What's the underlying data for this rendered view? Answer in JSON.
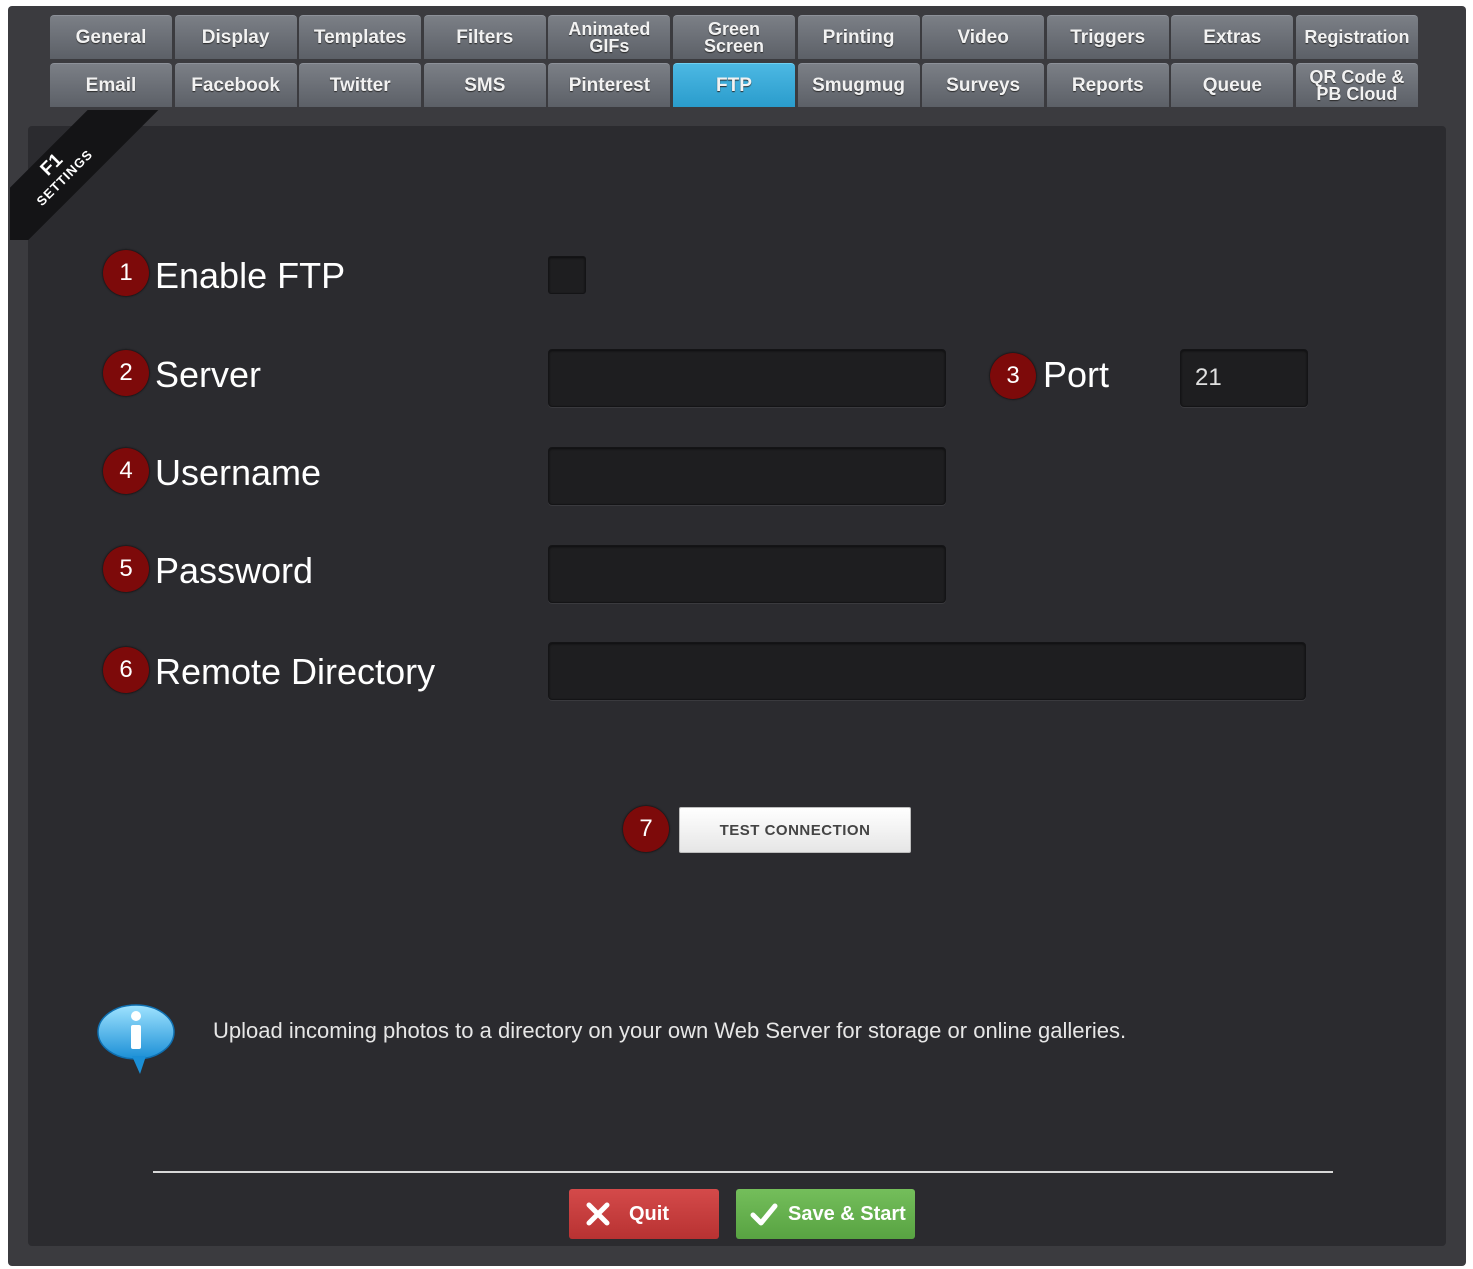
{
  "tabs_row1": [
    "General",
    "Display",
    "Templates",
    "Filters",
    "Animated\nGIFs",
    "Green\nScreen",
    "Printing",
    "Video",
    "Triggers",
    "Extras",
    "Registration"
  ],
  "tabs_row2": [
    "Email",
    "Facebook",
    "Twitter",
    "SMS",
    "Pinterest",
    "FTP",
    "Smugmug",
    "Surveys",
    "Reports",
    "Queue",
    "QR Code &\nPB Cloud"
  ],
  "active_tab": "FTP",
  "ribbon": {
    "key": "F1",
    "label": "SETTINGS"
  },
  "form": {
    "enable_ftp": {
      "badge": "1",
      "label": "Enable FTP",
      "checked": false
    },
    "server": {
      "badge": "2",
      "label": "Server",
      "value": ""
    },
    "port": {
      "badge": "3",
      "label": "Port",
      "value": "21"
    },
    "username": {
      "badge": "4",
      "label": "Username",
      "value": ""
    },
    "password": {
      "badge": "5",
      "label": "Password",
      "value": ""
    },
    "remote_directory": {
      "badge": "6",
      "label": "Remote Directory",
      "value": ""
    },
    "test": {
      "badge": "7",
      "label": "TEST CONNECTION"
    }
  },
  "info": {
    "icon": "info-icon",
    "text": "Upload incoming photos to a directory on your own Web Server for storage or online galleries."
  },
  "footer": {
    "quit_label": "Quit",
    "save_label": "Save & Start"
  },
  "colors": {
    "accent_tab": "#2a9ccc",
    "badge": "#7d0a0a",
    "quit": "#c43b3b",
    "save": "#63ad4c"
  }
}
